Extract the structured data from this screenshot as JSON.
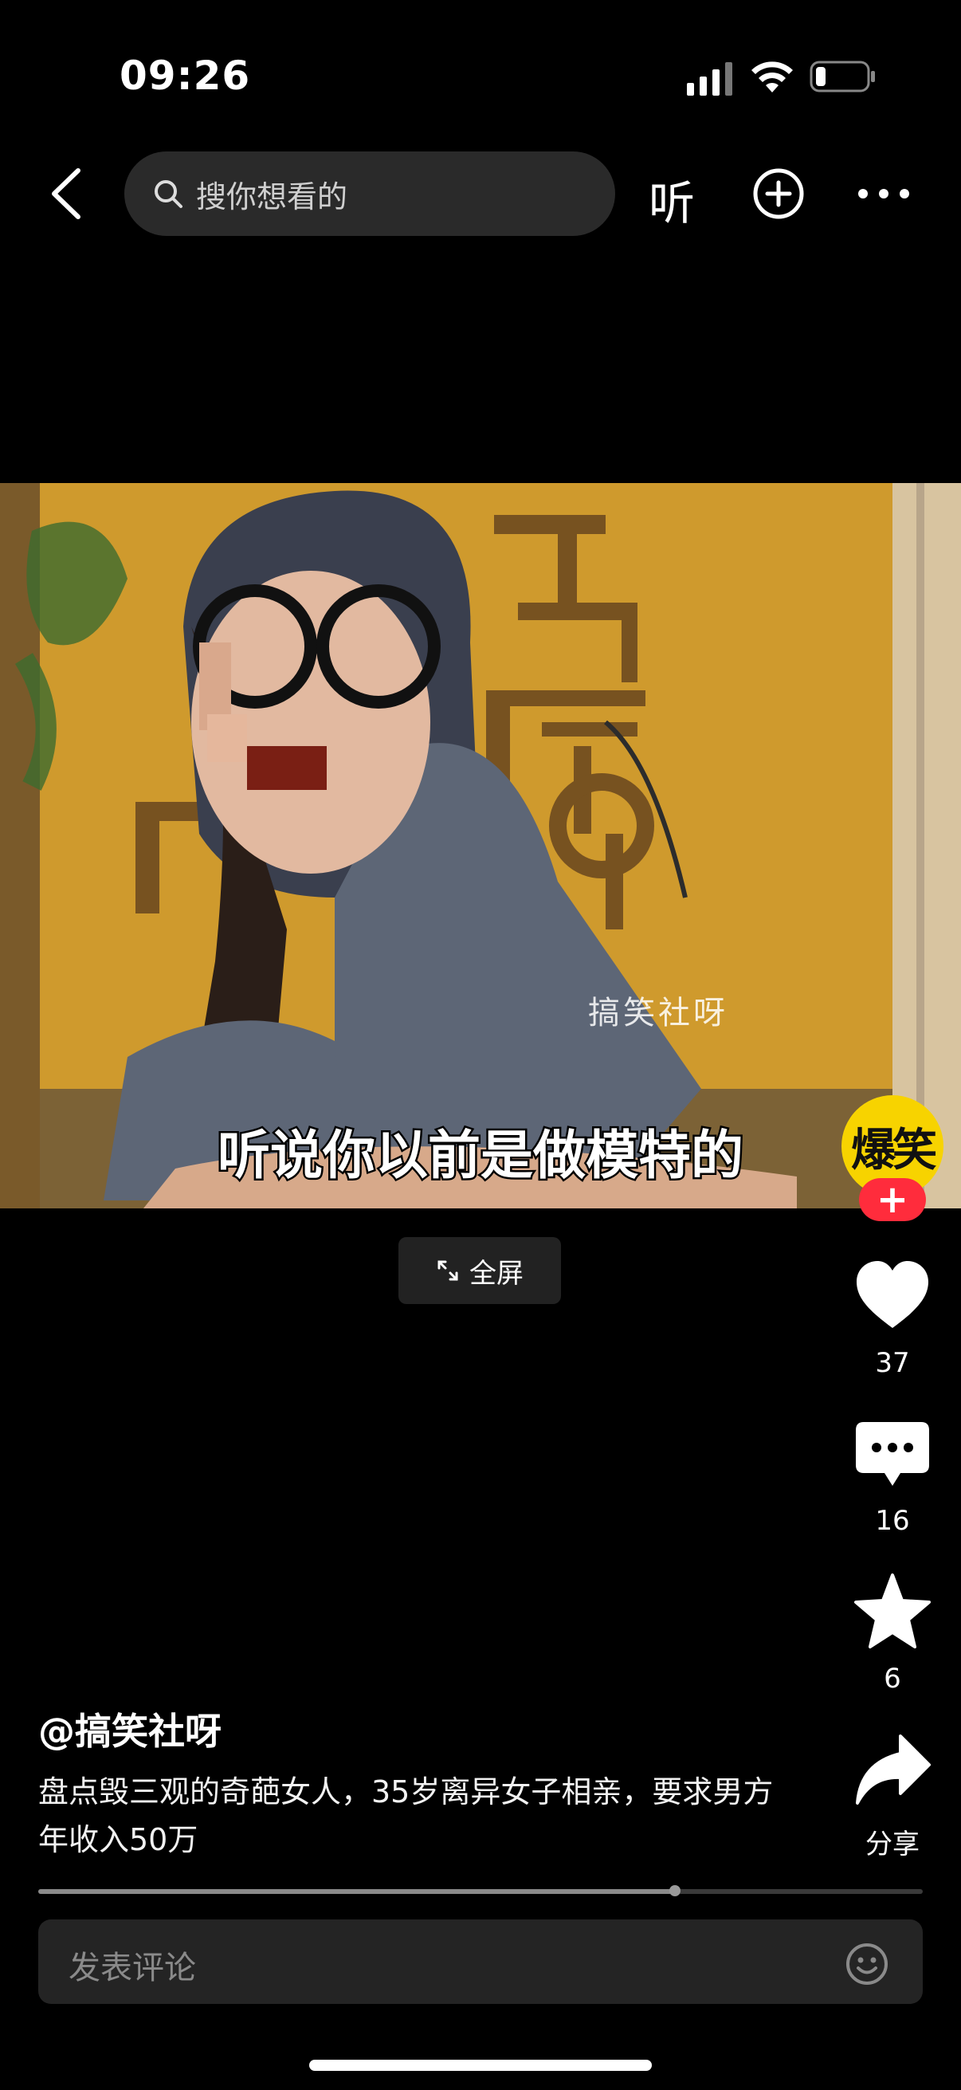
{
  "status_bar": {
    "time": "09:26",
    "battery_level": 0.15
  },
  "nav": {
    "search_placeholder": "搜你想看的",
    "listen_label": "听",
    "icons": [
      "back-icon",
      "search-icon",
      "add-icon",
      "more-icon"
    ]
  },
  "video": {
    "watermark": "搞笑社呀",
    "subtitle": "听说你以前是做模特的",
    "fullscreen_label": "全屏"
  },
  "author": {
    "avatar_text": "爆笑",
    "follow_label": "+",
    "handle": "@搞笑社呀"
  },
  "actions": {
    "likes": "37",
    "comments": "16",
    "favorites": "6",
    "share_label": "分享"
  },
  "description": "盘点毁三观的奇葩女人，35岁离异女子相亲，要求男方年收入50万",
  "progress": 0.72,
  "comment_placeholder": "发表评论",
  "colors": {
    "accent": "#ff2c3c",
    "avatar_bg": "#f7d300",
    "background": "#000000"
  }
}
